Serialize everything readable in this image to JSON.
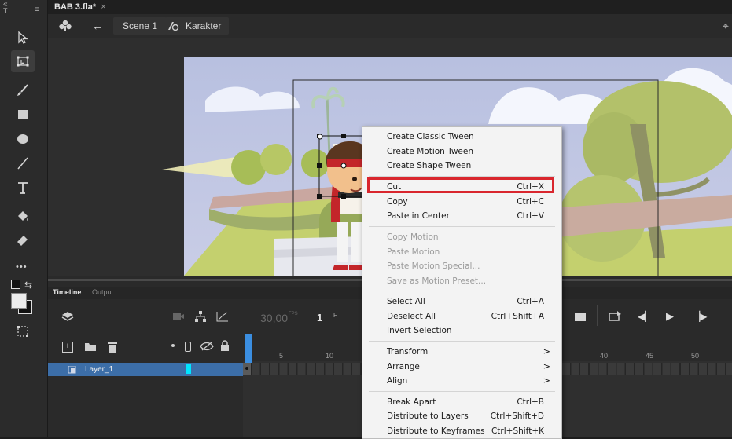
{
  "window": {
    "panel_tab": "T...",
    "doc_tab": "BAB 3.fla*",
    "doc_close": "×"
  },
  "editbar": {
    "back": "←",
    "scene": "Scene 1",
    "symbol": "Karakter"
  },
  "toolbar": {
    "tools": [
      "selection-icon",
      "free-transform-icon",
      "brush-icon",
      "rectangle-icon",
      "oval-icon",
      "line-icon",
      "text-icon",
      "paint-bucket-icon",
      "eraser-icon",
      "more-icon",
      "swap-colors-icon",
      "fill-color-icon",
      "snap-icon"
    ],
    "more": "•••"
  },
  "timeline": {
    "tabs": [
      "Timeline",
      "Output"
    ],
    "fps": "30,00",
    "fps_unit": "FPS",
    "frame": "1",
    "frame_unit": "F",
    "layer_name": "Layer_1",
    "ruler": [
      "5",
      "10",
      "40",
      "45",
      "50"
    ]
  },
  "context_menu": {
    "items": [
      {
        "label": "Create Classic Tween",
        "shortcut": "",
        "enabled": true
      },
      {
        "label": "Create Motion Tween",
        "shortcut": "",
        "enabled": true
      },
      {
        "label": "Create Shape Tween",
        "shortcut": "",
        "enabled": true
      },
      {
        "label": "Cut",
        "shortcut": "Ctrl+X",
        "enabled": true,
        "highlighted": true
      },
      {
        "label": "Copy",
        "shortcut": "Ctrl+C",
        "enabled": true
      },
      {
        "label": "Paste in Center",
        "shortcut": "Ctrl+V",
        "enabled": true
      },
      {
        "label": "Copy Motion",
        "shortcut": "",
        "enabled": false
      },
      {
        "label": "Paste Motion",
        "shortcut": "",
        "enabled": false
      },
      {
        "label": "Paste Motion Special...",
        "shortcut": "",
        "enabled": false
      },
      {
        "label": "Save as Motion Preset...",
        "shortcut": "",
        "enabled": false
      },
      {
        "label": "Select All",
        "shortcut": "Ctrl+A",
        "enabled": true
      },
      {
        "label": "Deselect All",
        "shortcut": "Ctrl+Shift+A",
        "enabled": true
      },
      {
        "label": "Invert Selection",
        "shortcut": "",
        "enabled": true
      },
      {
        "label": "Transform",
        "submenu": ">",
        "enabled": true
      },
      {
        "label": "Arrange",
        "submenu": ">",
        "enabled": true
      },
      {
        "label": "Align",
        "submenu": ">",
        "enabled": true
      },
      {
        "label": "Break Apart",
        "shortcut": "Ctrl+B",
        "enabled": true
      },
      {
        "label": "Distribute to Layers",
        "shortcut": "Ctrl+Shift+D",
        "enabled": true
      },
      {
        "label": "Distribute to Keyframes",
        "shortcut": "Ctrl+Shift+K",
        "enabled": true
      }
    ]
  },
  "colors": {
    "highlight_border": "#d9262e",
    "layer_selected": "#3c6ea8",
    "playhead": "#3b8ee0"
  }
}
